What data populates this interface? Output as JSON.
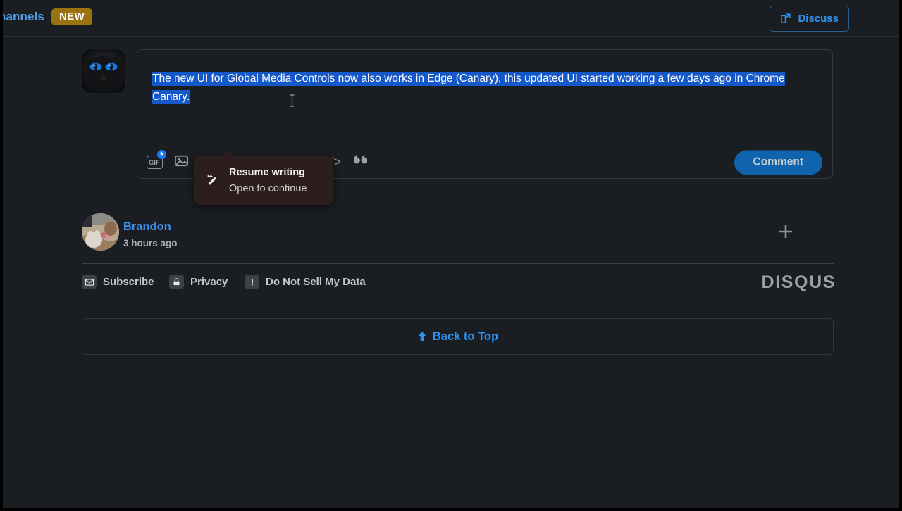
{
  "header": {
    "channels_label": "hannels",
    "new_badge": "NEW",
    "discuss_label": "Discuss",
    "discuss_icon": "edit-pencil-square-icon"
  },
  "composer": {
    "avatar_alt": "black-cat-avatar",
    "text_selected": "The new UI for Global Media Controls now also works in Edge (Canary), this updated UI started working a few days ago in Chrome Canary.",
    "toolbar": {
      "gif_label": "GIF",
      "gif_badge": "★",
      "image_icon": "image-icon",
      "code_icon": "</>",
      "quote_icon": "“"
    },
    "comment_button": "Comment"
  },
  "tooltip": {
    "title": "Resume writing",
    "subtitle": "Open to continue",
    "icon": "magic-wand-pencil-icon"
  },
  "comment": {
    "author": "Brandon",
    "timestamp": "3 hours ago",
    "expand_icon": "+"
  },
  "footer": {
    "links": [
      {
        "label": "Subscribe",
        "icon": "envelope-icon"
      },
      {
        "label": "Privacy",
        "icon": "lock-icon"
      },
      {
        "label": "Do Not Sell My Data",
        "icon": "exclamation-icon"
      }
    ],
    "brand": "DISQUS"
  },
  "back_to_top": {
    "label": "Back to Top",
    "icon": "arrow-up-icon"
  },
  "colors": {
    "page_background": "#1a1d21",
    "accent_blue": "#2a93f5",
    "selection_blue": "#1558c9",
    "badge_gold": "#9a7311",
    "comment_button": "#1064ad",
    "tooltip_background": "#2c1e1e"
  }
}
